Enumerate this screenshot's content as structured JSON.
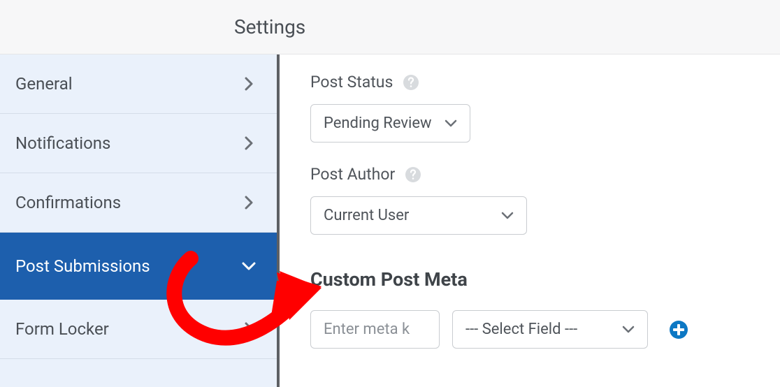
{
  "header": {
    "title": "Settings"
  },
  "sidebar": {
    "items": [
      {
        "label": "General"
      },
      {
        "label": "Notifications"
      },
      {
        "label": "Confirmations"
      },
      {
        "label": "Post Submissions"
      },
      {
        "label": "Form Locker"
      }
    ]
  },
  "panel": {
    "post_status": {
      "label": "Post Status",
      "value": "Pending Review"
    },
    "post_author": {
      "label": "Post Author",
      "value": "Current User"
    },
    "custom_meta": {
      "heading": "Custom Post Meta",
      "key_placeholder": "Enter meta k",
      "field_select": "--- Select Field ---"
    }
  }
}
